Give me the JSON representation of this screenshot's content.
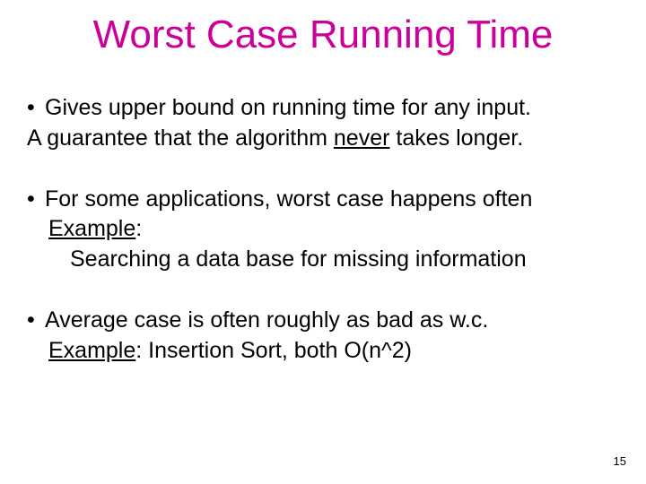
{
  "title": "Worst Case Running Time",
  "b1": "Gives upper bound on running time for any input.",
  "g1a": "A guarantee that the algorithm ",
  "g1b": "never",
  "g1c": " takes longer.",
  "b2": "For some applications, worst case happens often",
  "ex2a": "Example",
  "ex2b": ":",
  "ex2c": "Searching a data base for missing information",
  "b3": "Average case is often roughly as bad as w.c.",
  "ex3a": "Example",
  "ex3b": ": Insertion Sort, both O(n^2)",
  "page": "15"
}
